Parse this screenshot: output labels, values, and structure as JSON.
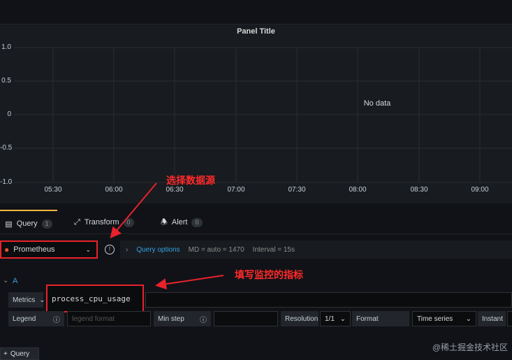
{
  "panel": {
    "title": "Panel Title",
    "no_data": "No data",
    "y_ticks": [
      "1.0",
      "0.5",
      "0",
      "-0.5",
      "-1.0"
    ],
    "x_ticks": [
      "05:30",
      "06:00",
      "06:30",
      "07:00",
      "07:30",
      "08:00",
      "08:30",
      "09:00"
    ]
  },
  "tabs": [
    {
      "label": "Query",
      "count": "1"
    },
    {
      "label": "Transform",
      "count": "0"
    },
    {
      "label": "Alert",
      "count": "0"
    }
  ],
  "datasource": {
    "label": "Prometheus"
  },
  "query_options": {
    "label": "Query options",
    "md": "MD = auto = 1470",
    "interval": "Interval = 15s"
  },
  "query": {
    "ref_id": "A",
    "metrics_label": "Metrics",
    "metric_value": "process_cpu_usage",
    "legend_label": "Legend",
    "legend_placeholder": "legend format",
    "min_step_label": "Min step",
    "resolution_label": "Resolution",
    "resolution_value": "1/1",
    "format_label": "Format",
    "format_value": "Time series",
    "instant_label": "Instant"
  },
  "add_query_label": "Query",
  "annotations": {
    "select_source": "选择数据源",
    "fill_metric": "填写监控的指标"
  },
  "watermark": "@稀土掘金技术社区",
  "colors": {
    "accent": "#33a2e5",
    "tab_active": "#f5b73d",
    "annotation": "#e8222c"
  }
}
